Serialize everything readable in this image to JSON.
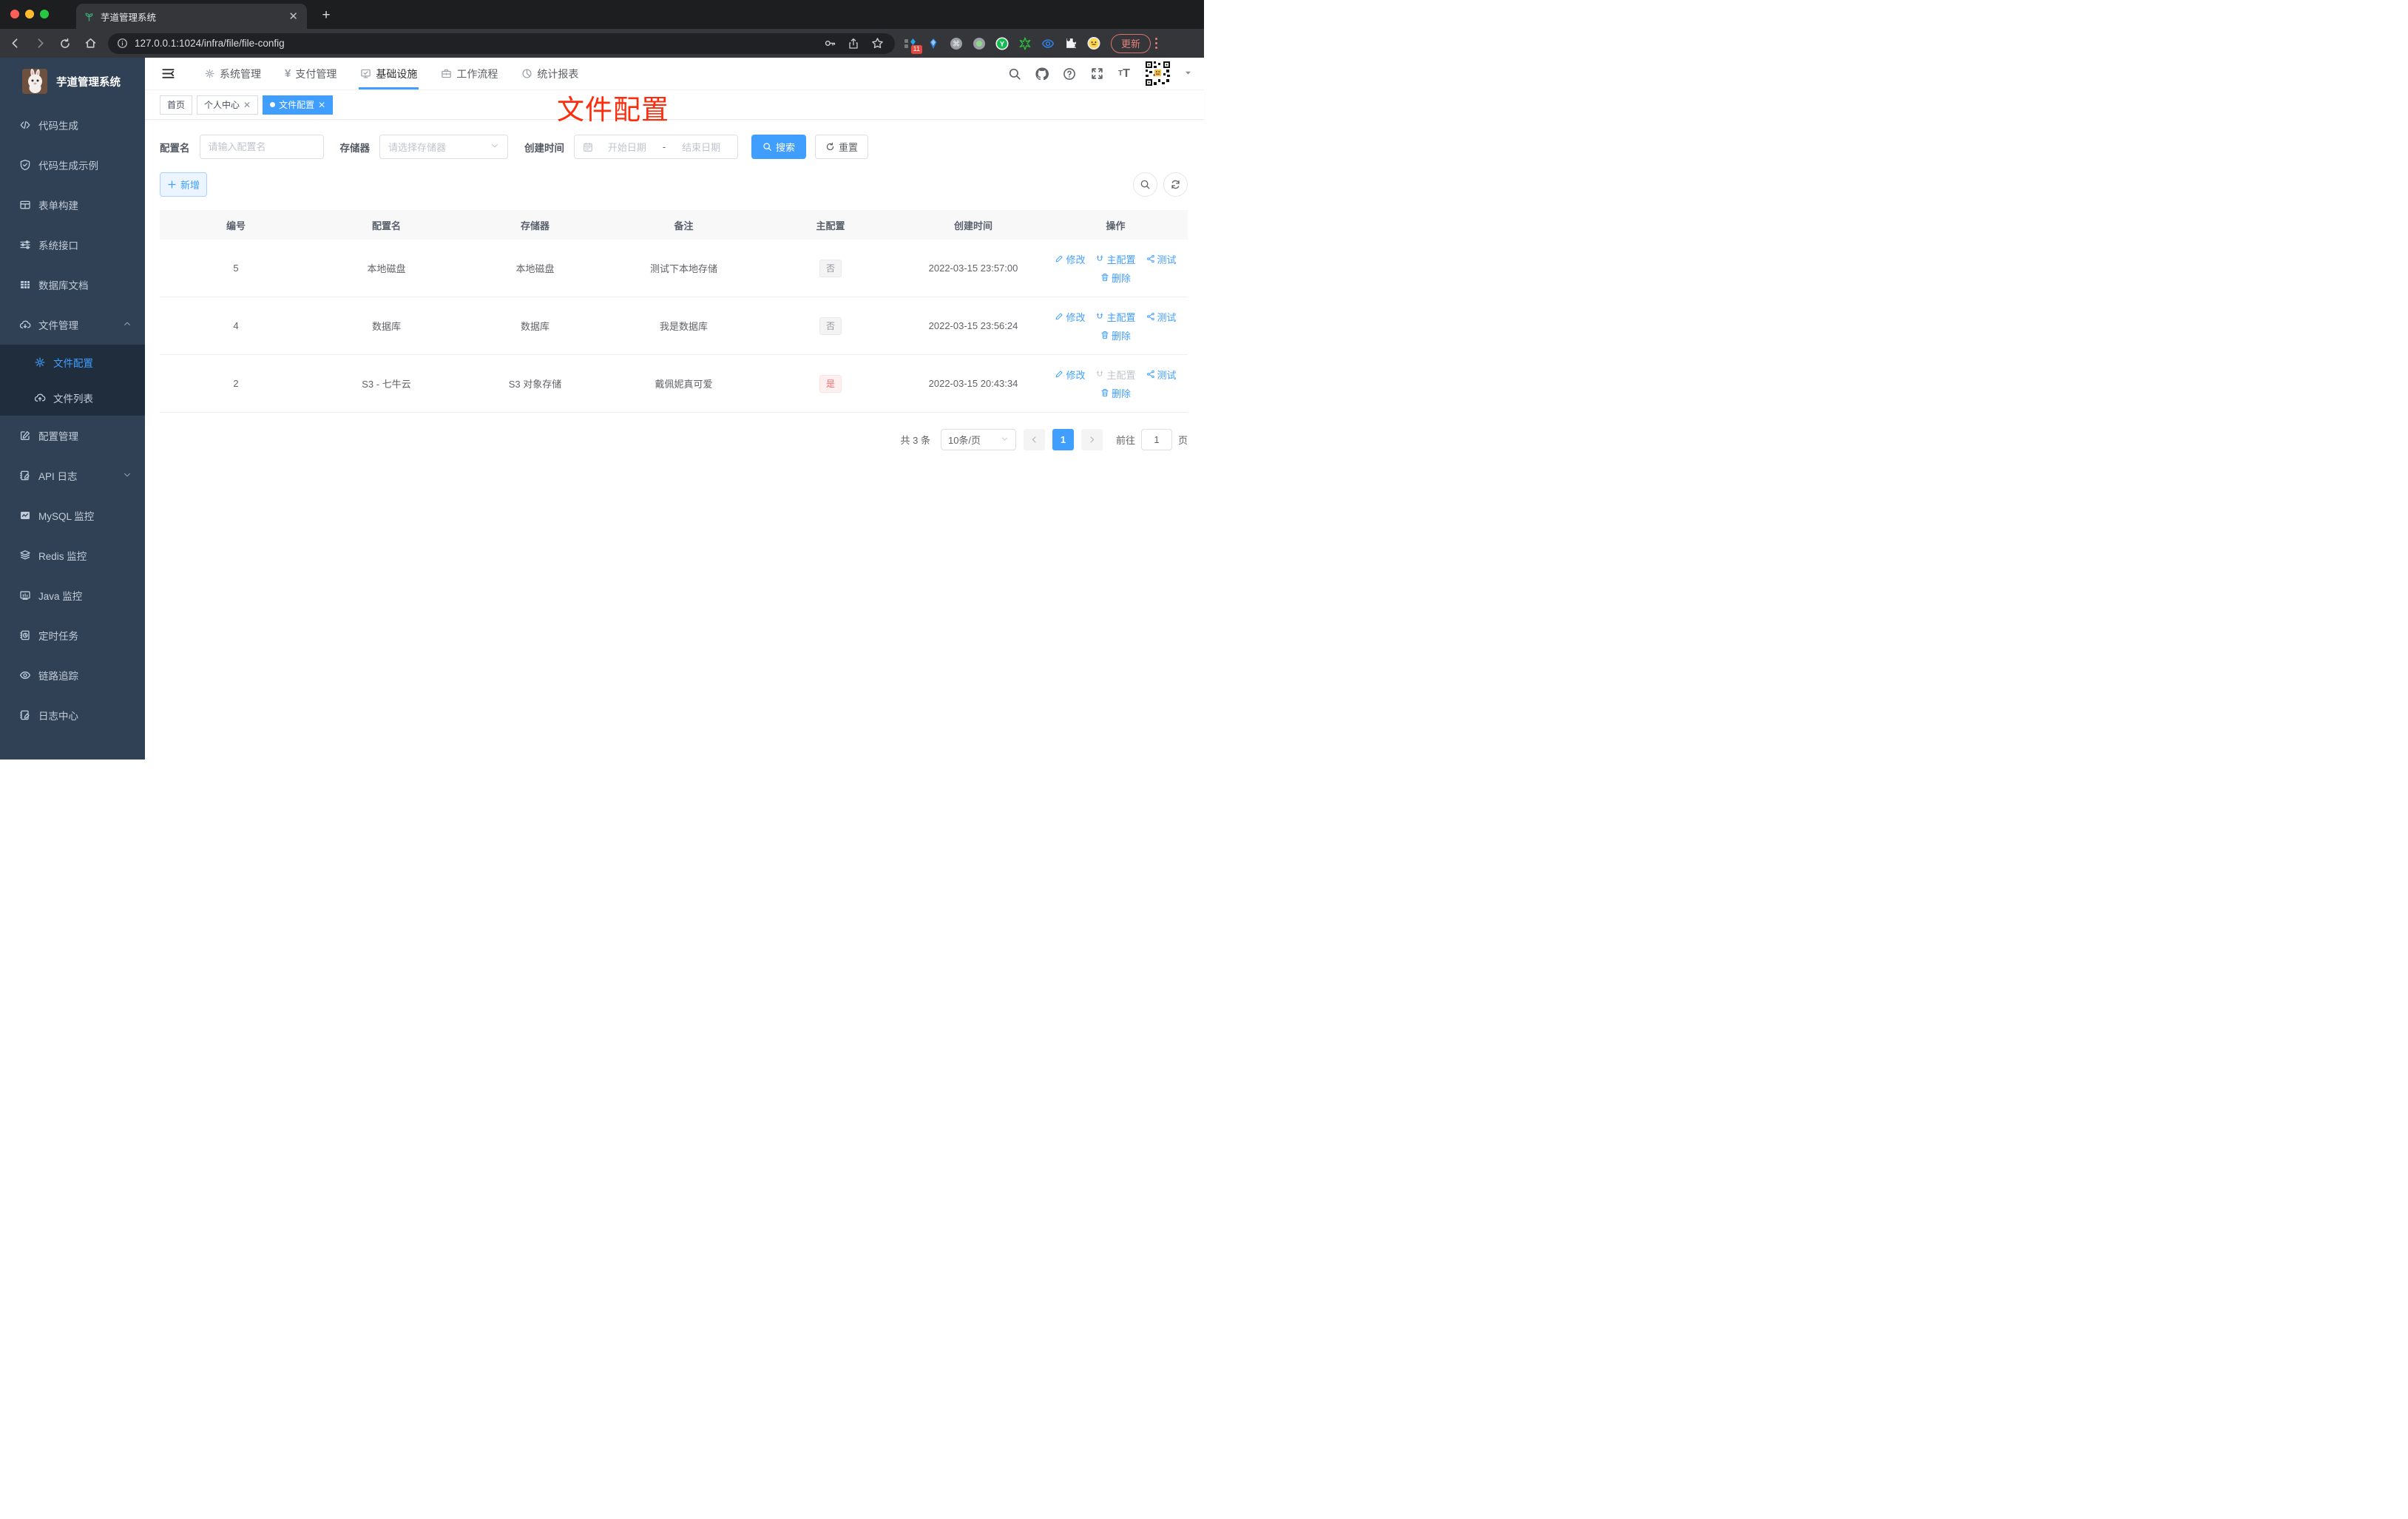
{
  "browser": {
    "tab_title": "芋道管理系统",
    "url": "127.0.0.1:1024/infra/file/file-config",
    "extension_badge": "11",
    "update_label": "更新"
  },
  "sidebar": {
    "title": "芋道管理系统",
    "items": [
      {
        "label": "代码生成"
      },
      {
        "label": "代码生成示例"
      },
      {
        "label": "表单构建"
      },
      {
        "label": "系统接口"
      },
      {
        "label": "数据库文档"
      },
      {
        "label": "文件管理"
      },
      {
        "label": "文件配置"
      },
      {
        "label": "文件列表"
      },
      {
        "label": "配置管理"
      },
      {
        "label": "API 日志"
      },
      {
        "label": "MySQL 监控"
      },
      {
        "label": "Redis 监控"
      },
      {
        "label": "Java 监控"
      },
      {
        "label": "定时任务"
      },
      {
        "label": "链路追踪"
      },
      {
        "label": "日志中心"
      }
    ]
  },
  "topnav": {
    "items": [
      {
        "label": "系统管理"
      },
      {
        "label": "支付管理"
      },
      {
        "label": "基础设施"
      },
      {
        "label": "工作流程"
      },
      {
        "label": "统计报表"
      }
    ]
  },
  "tags": {
    "home": "首页",
    "profile": "个人中心",
    "current": "文件配置"
  },
  "overlay": {
    "title": "文件配置"
  },
  "filters": {
    "name_label": "配置名",
    "name_placeholder": "请输入配置名",
    "storage_label": "存储器",
    "storage_placeholder": "请选择存储器",
    "created_label": "创建时间",
    "start_placeholder": "开始日期",
    "range_separator": "-",
    "end_placeholder": "结束日期",
    "search_label": "搜索",
    "reset_label": "重置"
  },
  "toolbar": {
    "add_label": "新增"
  },
  "table": {
    "columns": [
      "编号",
      "配置名",
      "存储器",
      "备注",
      "主配置",
      "创建时间",
      "操作"
    ],
    "actions": {
      "edit": "修改",
      "master": "主配置",
      "test": "测试",
      "remove": "删除"
    },
    "rows": [
      {
        "id": "5",
        "name": "本地磁盘",
        "storage": "本地磁盘",
        "remark": "测试下本地存储",
        "primary": "否",
        "created": "2022-03-15 23:57:00"
      },
      {
        "id": "4",
        "name": "数据库",
        "storage": "数据库",
        "remark": "我是数据库",
        "primary": "否",
        "created": "2022-03-15 23:56:24"
      },
      {
        "id": "2",
        "name": "S3 - 七牛云",
        "storage": "S3 对象存储",
        "remark": "戴佩妮真可爱",
        "primary": "是",
        "created": "2022-03-15 20:43:34"
      }
    ]
  },
  "pagination": {
    "total": "共 3 条",
    "size": "10条/页",
    "page": "1",
    "goto_label": "前往",
    "goto_value": "1",
    "unit": "页"
  },
  "colors": {
    "accent": "#409eff",
    "danger": "#f56c6c",
    "sidebar": "#304156"
  }
}
